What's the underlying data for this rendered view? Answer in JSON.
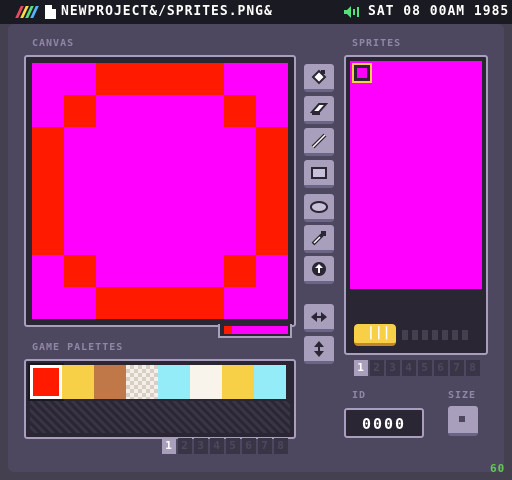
{
  "topbar": {
    "file_title": "NEWPROJECT&/SPRITES.PNG&",
    "clock": "SAT 08 00AM 1985",
    "logo_colors": [
      "#e84a5f",
      "#ffd84a",
      "#55e07a",
      "#56b4ff"
    ],
    "speaker_color": "#55e07a"
  },
  "labels": {
    "canvas": "CANVAS",
    "sprites": "SPRITES",
    "game_palettes": "GAME PALETTES",
    "id": "ID",
    "size": "SIZE"
  },
  "canvas": {
    "pixels": [
      "MMRRRRMM",
      "MRMMMMRM",
      "RMMMMMMR",
      "RMMMMMMR",
      "RMMMMMMR",
      "RMMMMMMR",
      "MRMMMMRM",
      "MMRRRRMM"
    ],
    "colors": {
      "M": "#ff00ff",
      "R": "#ff1a00"
    }
  },
  "tools": [
    "fill-tool-icon",
    "eraser-icon",
    "pencil-icon",
    "rectangle-icon",
    "ellipse-icon",
    "eyedropper-icon",
    "shift-icon",
    "flip-horizontal-icon",
    "flip-vertical-icon"
  ],
  "palette": {
    "swatches": [
      "#ff1a00",
      "#f8d048",
      "#c07848",
      "transparent",
      "#94ecf8",
      "#f8f4ec",
      "#f8d048",
      "#94ecf8"
    ],
    "selected": 0
  },
  "pages": [
    "1",
    "2",
    "3",
    "4",
    "5",
    "6",
    "7",
    "8"
  ],
  "sprite": {
    "id": "0000",
    "background": "#ff00ff"
  },
  "fps": "60"
}
